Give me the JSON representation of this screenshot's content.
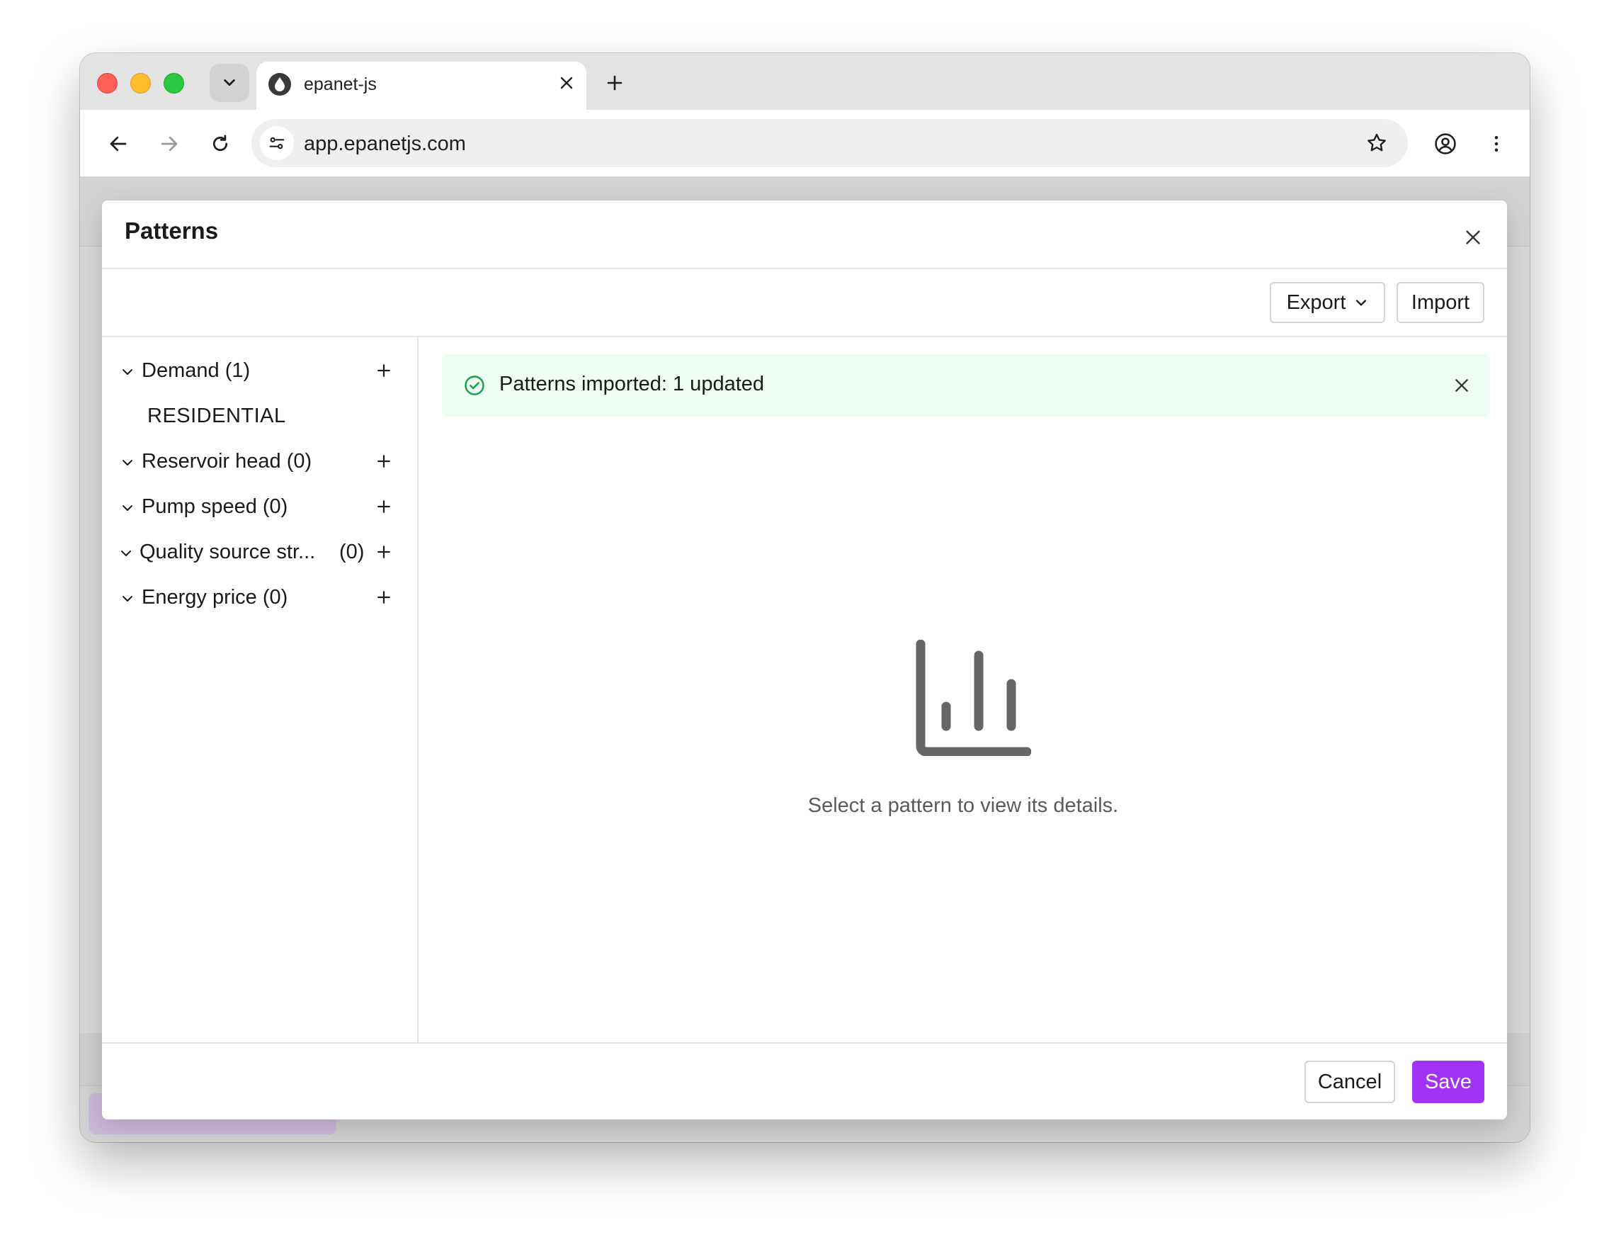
{
  "browser": {
    "tab_title": "epanet-js",
    "url": "app.epanetjs.com",
    "icons": [
      "tab-search-icon",
      "close-icon",
      "new-tab-icon",
      "back-icon",
      "forward-icon",
      "reload-icon",
      "site-info-icon",
      "bookmark-star-icon",
      "profile-icon",
      "menu-dots-icon"
    ]
  },
  "modal": {
    "title": "Patterns",
    "export_label": "Export",
    "import_label": "Import",
    "groups": [
      {
        "label": "Demand",
        "count": "(1)",
        "items": [
          "RESIDENTIAL"
        ]
      },
      {
        "label": "Reservoir head",
        "count": "(0)",
        "items": []
      },
      {
        "label": "Pump speed",
        "count": "(0)",
        "items": []
      },
      {
        "label": "Quality source str...",
        "count": "(0)",
        "items": []
      },
      {
        "label": "Energy price",
        "count": "(0)",
        "items": []
      }
    ],
    "toast": {
      "text": "Patterns imported: 1 updated",
      "color": "#edfbf2",
      "icon_color": "#16a34a"
    },
    "empty_state": "Select a pattern to view its details.",
    "cancel_label": "Cancel",
    "save_label": "Save",
    "accent": "#a332f7"
  }
}
